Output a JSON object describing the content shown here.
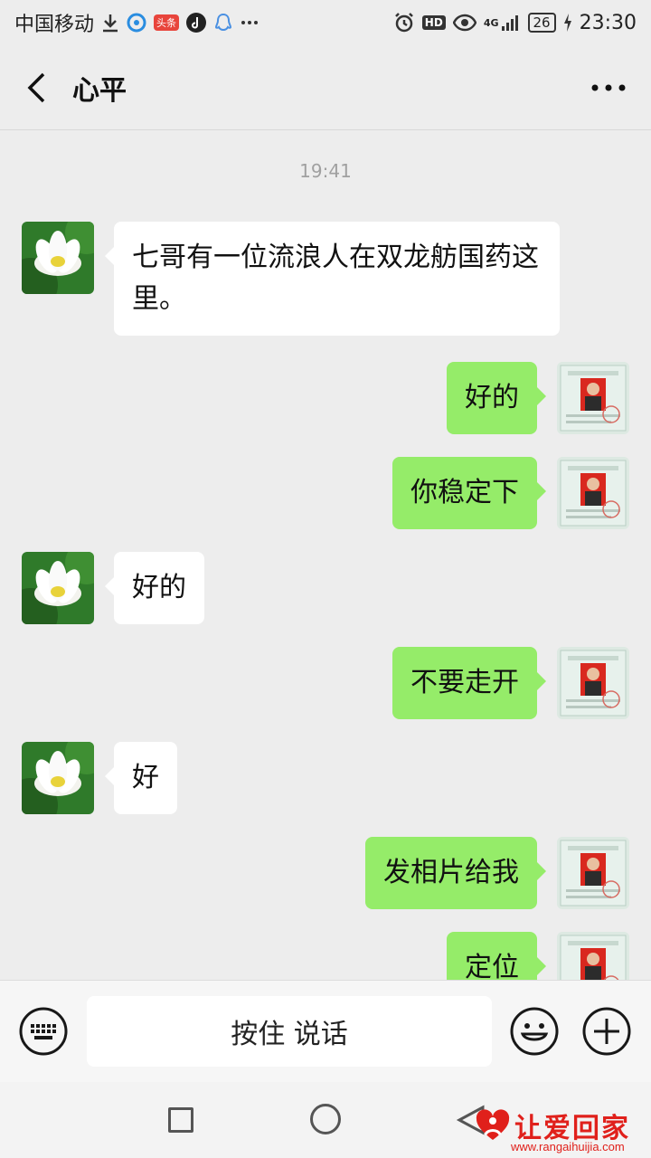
{
  "status_bar": {
    "carrier": "中国移动",
    "toutiao_badge": "头条",
    "network": "4G",
    "battery": "26",
    "time": "23:30"
  },
  "header": {
    "title": "心平",
    "back_icon": "chevron-left-icon",
    "more_icon": "more-dots-icon"
  },
  "chat": {
    "timestamp": "19:41",
    "messages": [
      {
        "from": "contact",
        "text": "七哥有一位流浪人在双龙舫国药这里。"
      },
      {
        "from": "me",
        "text": "好的"
      },
      {
        "from": "me",
        "text": "你稳定下"
      },
      {
        "from": "contact",
        "text": "好的"
      },
      {
        "from": "me",
        "text": "不要走开"
      },
      {
        "from": "contact",
        "text": "好"
      },
      {
        "from": "me",
        "text": "发相片给我"
      },
      {
        "from": "me",
        "text": "定位"
      }
    ]
  },
  "input_bar": {
    "hold_to_talk": "按住 说话",
    "keyboard_icon": "keyboard-icon",
    "emoji_icon": "emoji-icon",
    "plus_icon": "plus-icon"
  },
  "watermark": {
    "text": "让爱回家",
    "url": "www.rangaihuijia.com"
  },
  "colors": {
    "outgoing_bubble": "#95ec69",
    "incoming_bubble": "#ffffff",
    "background": "#ededed",
    "watermark": "#e0201b"
  }
}
